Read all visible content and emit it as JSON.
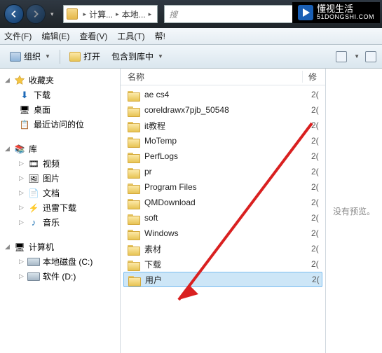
{
  "watermark": {
    "title": "懂视生活",
    "sub": "51DONGSHI.COM"
  },
  "breadcrumb": {
    "seg1": "计算...",
    "seg2": "本地..."
  },
  "search": {
    "placeholder": "搜"
  },
  "menu": {
    "file": "文件(F)",
    "edit": "编辑(E)",
    "view": "查看(V)",
    "tools": "工具(T)",
    "help": "帮!"
  },
  "toolbar": {
    "organize": "组织",
    "open": "打开",
    "include": "包含到库中"
  },
  "sidebar": {
    "favorites": "收藏夹",
    "downloads": "下载",
    "desktop": "桌面",
    "recent": "最近访问的位",
    "libraries": "库",
    "videos": "视频",
    "pictures": "图片",
    "documents": "文档",
    "thunder": "迅雷下载",
    "music": "音乐",
    "computer": "计算机",
    "drive_c": "本地磁盘 (C:)",
    "drive_d": "软件 (D:)"
  },
  "columns": {
    "name": "名称",
    "modified": "修"
  },
  "files": [
    {
      "name": "ae cs4",
      "date": "2("
    },
    {
      "name": "coreldrawx7pjb_50548",
      "date": "2("
    },
    {
      "name": "it教程",
      "date": "2("
    },
    {
      "name": "MoTemp",
      "date": "2("
    },
    {
      "name": "PerfLogs",
      "date": "2("
    },
    {
      "name": "pr",
      "date": "2("
    },
    {
      "name": "Program Files",
      "date": "2("
    },
    {
      "name": "QMDownload",
      "date": "2("
    },
    {
      "name": "soft",
      "date": "2("
    },
    {
      "name": "Windows",
      "date": "2("
    },
    {
      "name": "素材",
      "date": "2("
    },
    {
      "name": "下载",
      "date": "2("
    },
    {
      "name": "用户",
      "date": "2("
    }
  ],
  "selected_index": 12,
  "preview": {
    "text": "没有预览。"
  }
}
